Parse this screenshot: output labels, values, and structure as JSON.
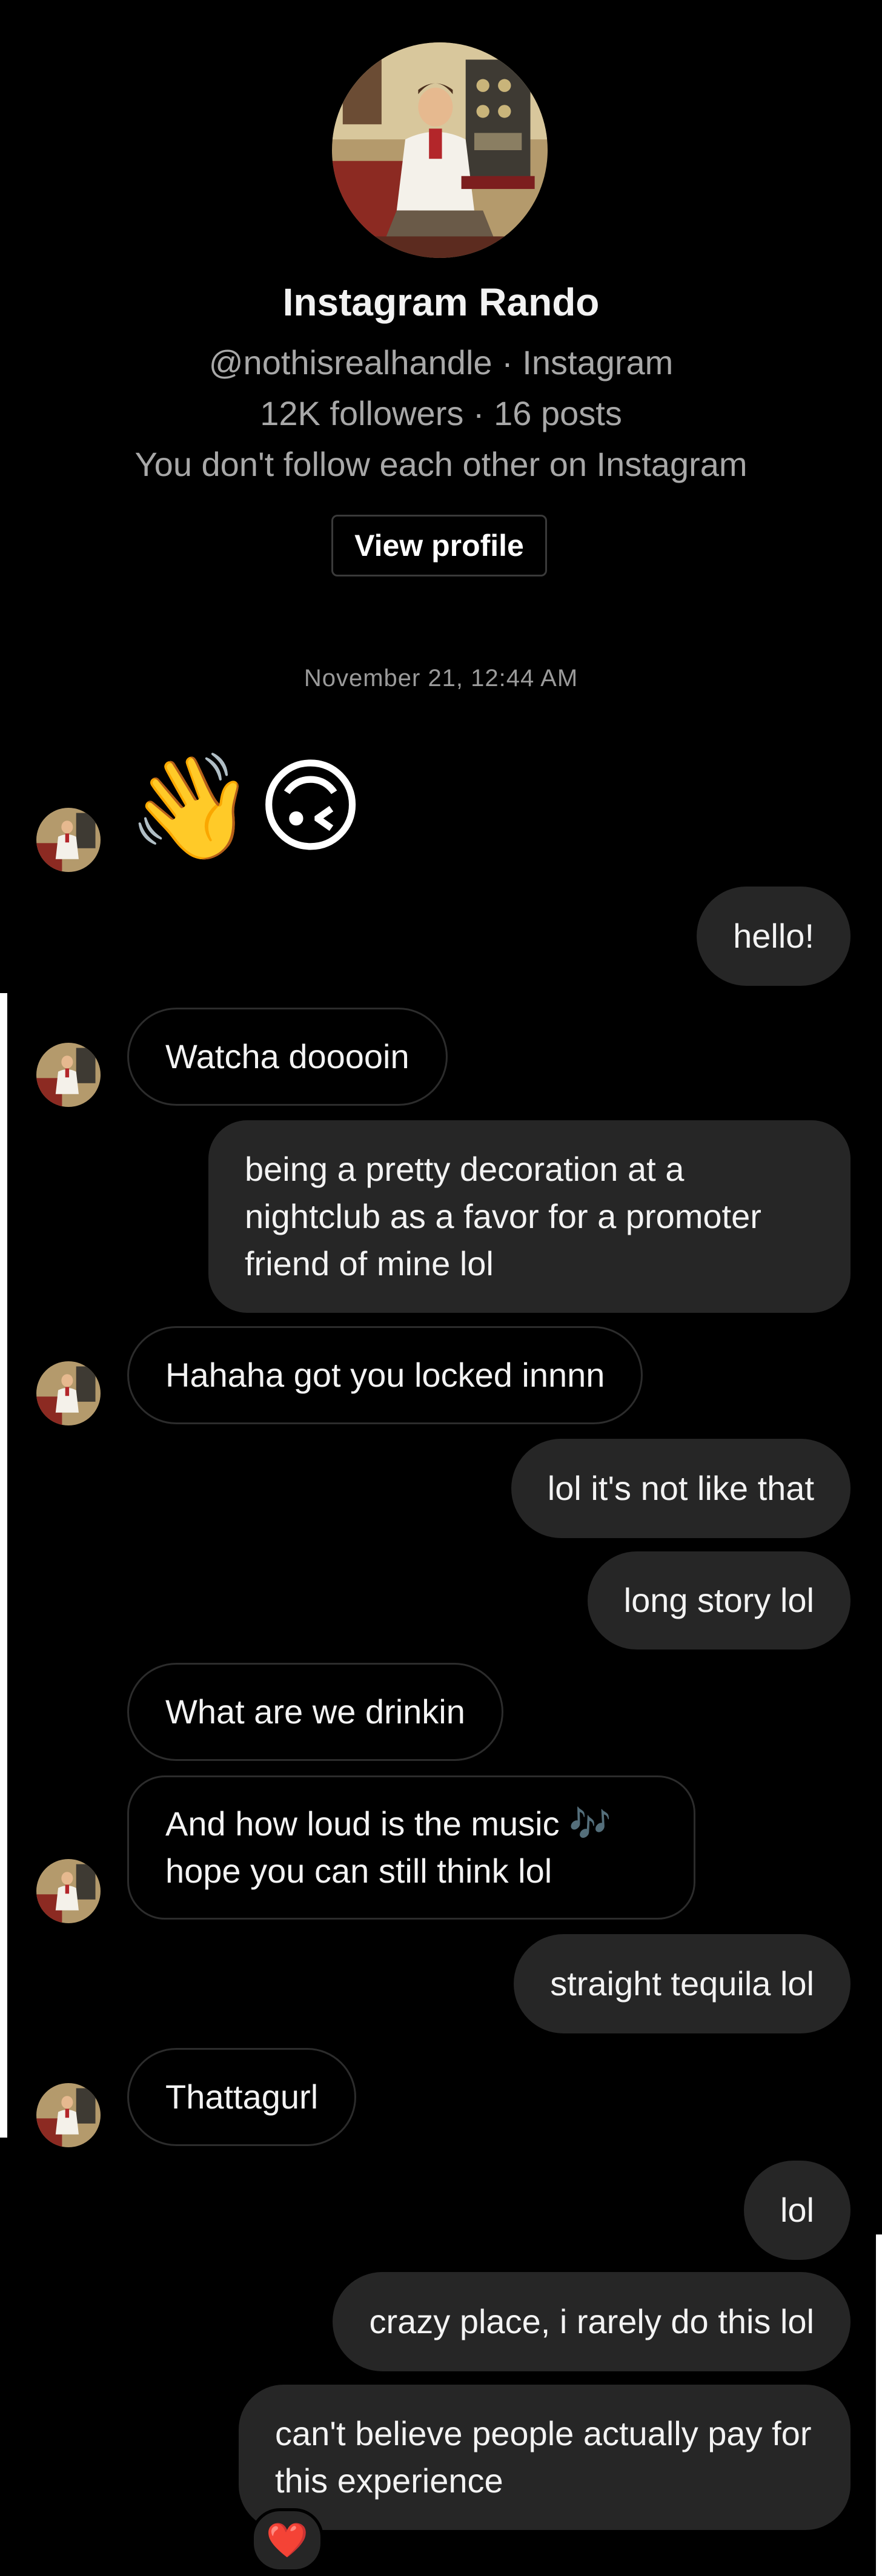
{
  "profile": {
    "name": "Instagram Rando",
    "handle": "@nothisrealhandle · Instagram",
    "stats": "12K followers · 16 posts",
    "follow_status": "You don't follow each other on Instagram",
    "view_profile_label": "View profile"
  },
  "conversation": {
    "timestamp": "November 21, 12:44 AM",
    "emoji_message": [
      "👋",
      "🙃"
    ],
    "messages": [
      {
        "from": "me",
        "text": "hello!"
      },
      {
        "from": "them",
        "text": "Watcha dooooin"
      },
      {
        "from": "me",
        "text": "being a pretty decoration at a nightclub as a favor for a promoter friend of mine lol"
      },
      {
        "from": "them",
        "text": "Hahaha got you locked innnn"
      },
      {
        "from": "me",
        "text": "lol it's not like that"
      },
      {
        "from": "me",
        "text": "long story lol"
      },
      {
        "from": "them",
        "text": "What are we drinkin"
      },
      {
        "from": "them",
        "text": "And how loud is the music 🎶 hope you can still think lol"
      },
      {
        "from": "me",
        "text": "straight tequila lol"
      },
      {
        "from": "them",
        "text": "Thattagurl"
      },
      {
        "from": "me",
        "text": "lol"
      },
      {
        "from": "me",
        "text": "crazy place, i rarely do this lol"
      },
      {
        "from": "me",
        "text": "can't believe people actually pay for this experience",
        "reaction": "❤️"
      }
    ]
  },
  "colors": {
    "background": "#000000",
    "outgoing_bubble": "#262626",
    "incoming_border": "#2c2c2c",
    "secondary_text": "#a8a8a8",
    "reaction_heart": "#e0245e"
  },
  "icons": {
    "avatar": "vintage-radio-man-avatar",
    "reaction": "heart-icon"
  }
}
